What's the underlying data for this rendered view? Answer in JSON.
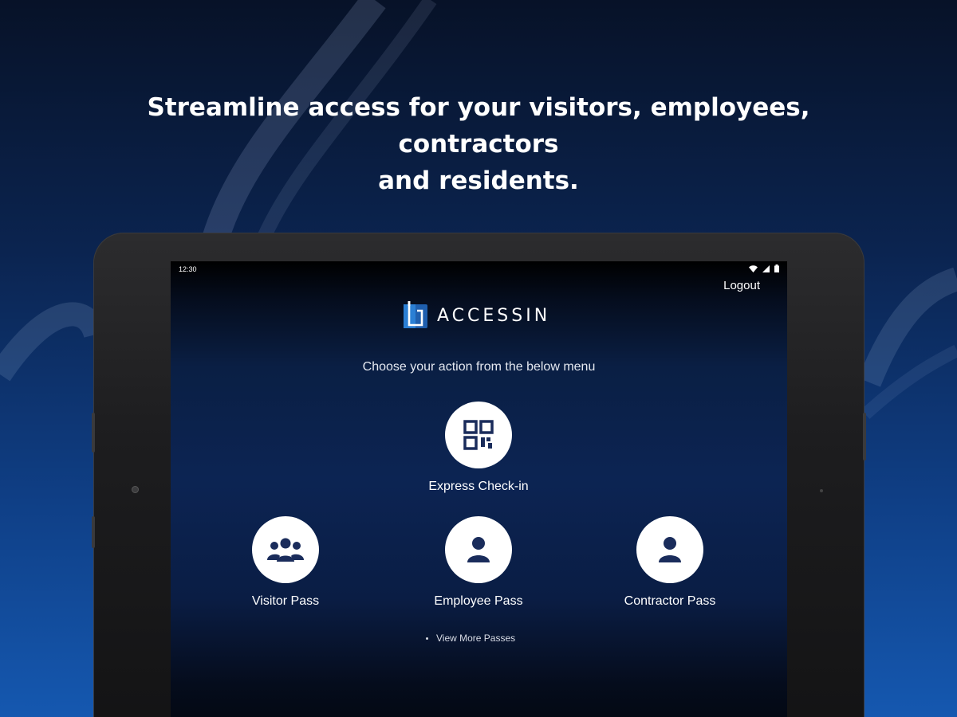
{
  "promo": {
    "headline_line1": "Streamline access for your visitors, employees, contractors",
    "headline_line2": "and residents."
  },
  "status_bar": {
    "time": "12:30",
    "icons": [
      "wifi-icon",
      "signal-icon",
      "battery-icon"
    ]
  },
  "app": {
    "logout_label": "Logout",
    "brand_name": "ACCESSIN",
    "prompt": "Choose your action from the below menu",
    "actions": [
      {
        "label": "Express Check-in",
        "icon": "qr-code-icon"
      },
      {
        "label": "Visitor Pass",
        "icon": "group-icon"
      },
      {
        "label": "Employee Pass",
        "icon": "person-icon"
      },
      {
        "label": "Contractor Pass",
        "icon": "person-icon"
      }
    ],
    "more_label": "View More Passes"
  },
  "colors": {
    "icon_navy": "#1a2c5b",
    "background_top": "#071228",
    "background_bottom": "#1558b0",
    "logo_blue": "#2b7fd4"
  }
}
